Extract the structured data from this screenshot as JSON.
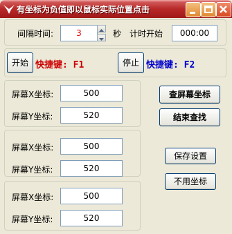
{
  "window": {
    "title": "有坐标为负值即以鼠标实际位置点击",
    "icon": "app-logo-icon"
  },
  "timer": {
    "interval_label": "间隔时间:",
    "interval_value": "3",
    "unit_label": "秒",
    "start_label": "计时开始",
    "start_time": "000:00"
  },
  "controls": {
    "start_button": "开始",
    "start_hotkey": "快捷键: F1",
    "stop_button": "停止",
    "stop_hotkey": "快捷键: F2"
  },
  "groups": [
    {
      "x_label": "屏幕X坐标:",
      "x_value": "500",
      "y_label": "屏幕Y坐标:",
      "y_value": "520"
    },
    {
      "x_label": "屏幕X坐标:",
      "x_value": "500",
      "y_label": "屏幕Y坐标:",
      "y_value": "520"
    },
    {
      "x_label": "屏幕X坐标:",
      "x_value": "500",
      "y_label": "屏幕Y坐标:",
      "y_value": "520"
    }
  ],
  "actions": {
    "find_coords": "查屏幕坐标",
    "end_find": "结束查找",
    "save_settings": "保存设置",
    "no_coords": "不用坐标"
  },
  "colors": {
    "title_bar": "#b82828",
    "interval_text": "#e00000",
    "start_hotkey": "#cc0000",
    "stop_hotkey": "#0000cc"
  }
}
